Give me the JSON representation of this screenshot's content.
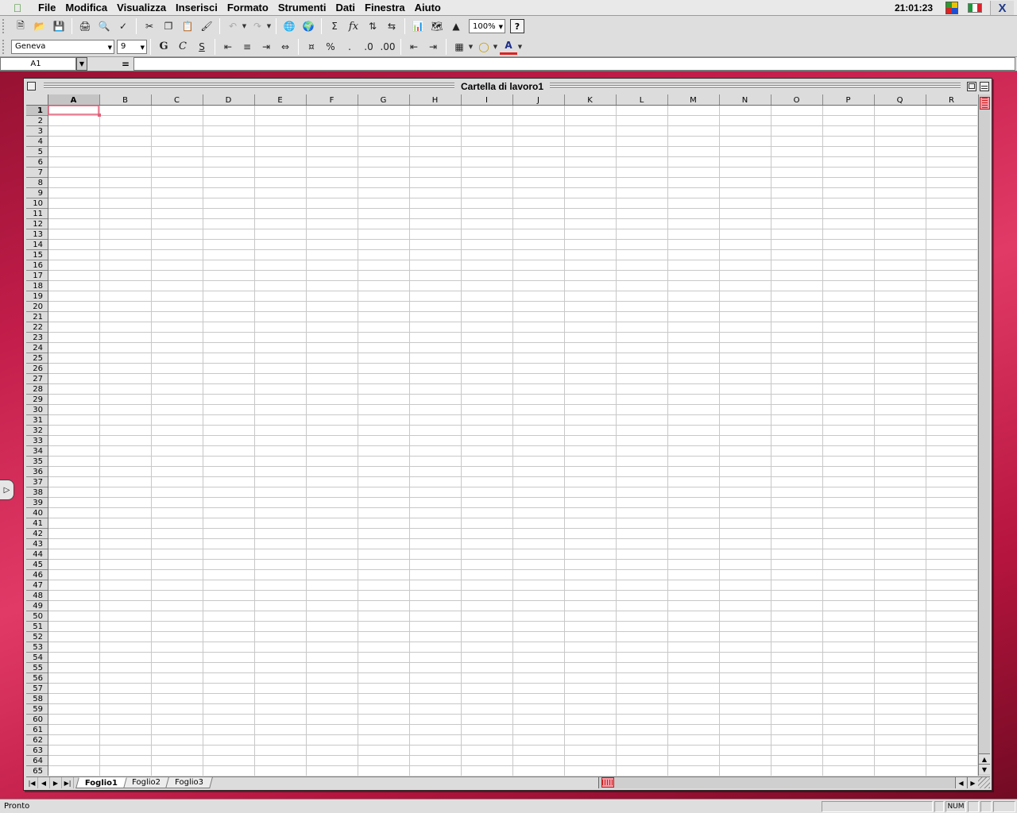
{
  "menubar": {
    "items": [
      "File",
      "Modifica",
      "Visualizza",
      "Inserisci",
      "Formato",
      "Strumenti",
      "Dati",
      "Finestra",
      "Aiuto"
    ],
    "clock": "21:01:23"
  },
  "toolbar_format": {
    "font": "Geneva",
    "size": "9",
    "bold": "G",
    "italic": "C",
    "underline": "S",
    "percent": "%",
    "comma": "."
  },
  "toolbar_standard": {
    "zoom": "100%",
    "sum": "Σ",
    "help": "?"
  },
  "formula_bar": {
    "name_box": "A1",
    "equals": "=",
    "formula": ""
  },
  "window": {
    "title": "Cartella di lavoro1"
  },
  "sheet": {
    "columns": [
      "A",
      "B",
      "C",
      "D",
      "E",
      "F",
      "G",
      "H",
      "I",
      "J",
      "K",
      "L",
      "M",
      "N",
      "O",
      "P",
      "Q",
      "R"
    ],
    "row_count": 65,
    "active_cell": "A1"
  },
  "tabs": [
    "Foglio1",
    "Foglio2",
    "Foglio3"
  ],
  "active_tab": "Foglio1",
  "status": {
    "text": "Pronto",
    "num": "NUM"
  },
  "colors": {
    "selection": "#e0607a",
    "desktop": "#c21d4a",
    "chrome": "#dedede"
  }
}
